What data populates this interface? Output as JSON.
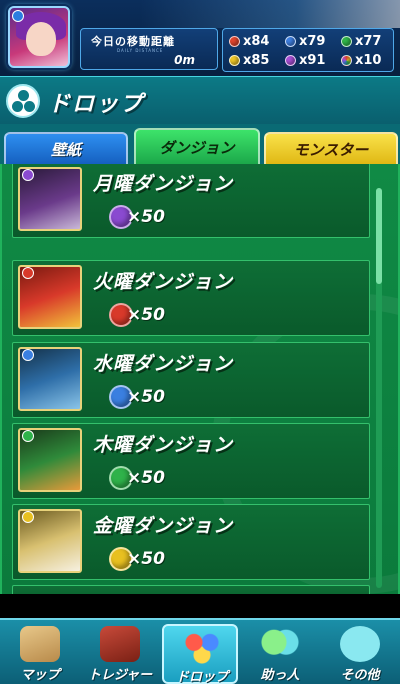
{
  "header": {
    "distance_label": "今日の移動距離",
    "distance_sub": "DAILY DISTANCE",
    "distance_value": "0m",
    "stones": [
      {
        "color": "#e3462f",
        "icon": "fire-orb-icon",
        "value": "x84"
      },
      {
        "color": "#3f7fe0",
        "icon": "water-orb-icon",
        "value": "x79"
      },
      {
        "color": "#31b64a",
        "icon": "wood-orb-icon",
        "value": "x77"
      },
      {
        "color": "#f0c828",
        "icon": "light-orb-icon",
        "value": "x85"
      },
      {
        "color": "#a94fd6",
        "icon": "dark-orb-icon",
        "value": "x91"
      },
      {
        "color": "#56c8e8",
        "icon": "rainbow-orb-icon",
        "value": "x10"
      }
    ]
  },
  "page": {
    "title": "ドロップ"
  },
  "tabs": [
    {
      "label": "壁紙"
    },
    {
      "label": "ダンジョン",
      "active": true
    },
    {
      "label": "モンスター"
    }
  ],
  "dungeons": [
    {
      "name": "月曜ダンジョン",
      "reward": "×50",
      "orb_color": "#8a4ad0",
      "attr_color": "#8a4ad0",
      "icon": "dark-orb-icon"
    },
    {
      "name": "火曜ダンジョン",
      "reward": "×50",
      "orb_color": "#d8392a",
      "attr_color": "#d8392a",
      "icon": "fire-orb-icon"
    },
    {
      "name": "水曜ダンジョン",
      "reward": "×50",
      "orb_color": "#3a7fe0",
      "attr_color": "#3a7fe0",
      "icon": "water-orb-icon"
    },
    {
      "name": "木曜ダンジョン",
      "reward": "×50",
      "orb_color": "#2fb24a",
      "attr_color": "#2fb24a",
      "icon": "wood-orb-icon"
    },
    {
      "name": "金曜ダンジョン",
      "reward": "×50",
      "orb_color": "#e8c020",
      "attr_color": "#e8c020",
      "icon": "light-orb-icon"
    }
  ],
  "nav": [
    {
      "label": "マップ",
      "icon": "map-icon"
    },
    {
      "label": "トレジャー",
      "icon": "treasure-chest-icon"
    },
    {
      "label": "ドロップ",
      "icon": "drop-orbs-icon",
      "active": true
    },
    {
      "label": "助っ人",
      "icon": "helper-icon"
    },
    {
      "label": "その他",
      "icon": "question-icon"
    }
  ]
}
